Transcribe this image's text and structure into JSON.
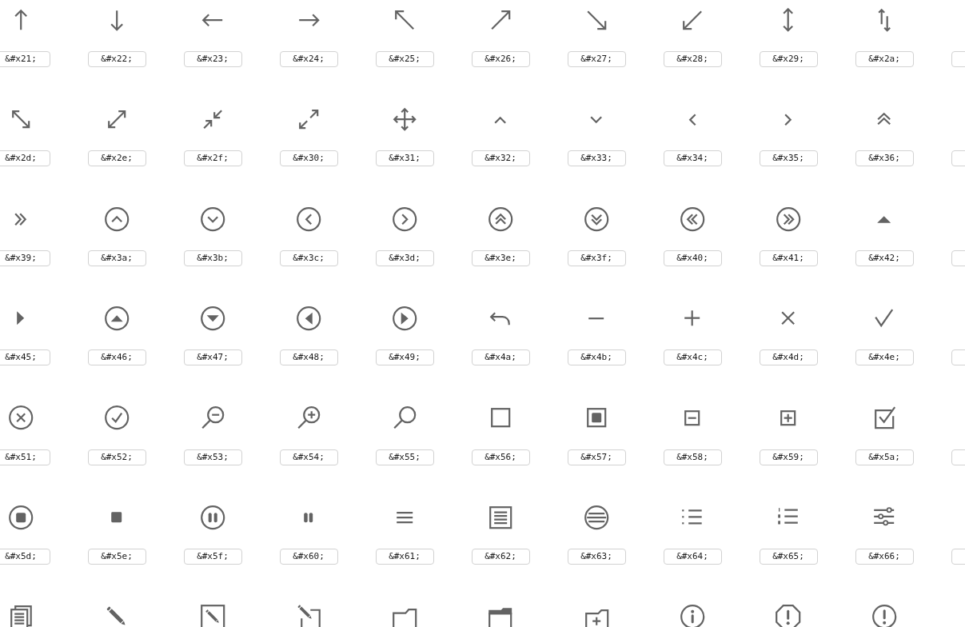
{
  "icon_grid": {
    "rows": [
      {
        "cells": [
          {
            "kind": "arrow-up",
            "code": "&#x21;"
          },
          {
            "kind": "arrow-down",
            "code": "&#x22;"
          },
          {
            "kind": "arrow-left",
            "code": "&#x23;"
          },
          {
            "kind": "arrow-right",
            "code": "&#x24;"
          },
          {
            "kind": "arrow-up-left",
            "code": "&#x25;"
          },
          {
            "kind": "arrow-up-right",
            "code": "&#x26;"
          },
          {
            "kind": "arrow-down-right",
            "code": "&#x27;"
          },
          {
            "kind": "arrow-down-left",
            "code": "&#x28;"
          },
          {
            "kind": "double-arrow-vertical",
            "code": "&#x29;"
          },
          {
            "kind": "up-down-arrows",
            "code": "&#x2a;"
          }
        ]
      },
      {
        "cells": [
          {
            "kind": "double-arrow-diagonal-down",
            "code": "&#x2d;"
          },
          {
            "kind": "double-arrow-diagonal-up",
            "code": "&#x2e;"
          },
          {
            "kind": "collapse-arrows",
            "code": "&#x2f;"
          },
          {
            "kind": "expand-arrows",
            "code": "&#x30;"
          },
          {
            "kind": "move-arrows",
            "code": "&#x31;"
          },
          {
            "kind": "chevron-up",
            "code": "&#x32;"
          },
          {
            "kind": "chevron-down",
            "code": "&#x33;"
          },
          {
            "kind": "chevron-left",
            "code": "&#x34;"
          },
          {
            "kind": "chevron-right",
            "code": "&#x35;"
          },
          {
            "kind": "double-chevron-up",
            "code": "&#x36;"
          }
        ]
      },
      {
        "cells": [
          {
            "kind": "double-chevron-right",
            "code": "&#x39;"
          },
          {
            "kind": "circle-chevron-up",
            "code": "&#x3a;"
          },
          {
            "kind": "circle-chevron-down",
            "code": "&#x3b;"
          },
          {
            "kind": "circle-chevron-left",
            "code": "&#x3c;"
          },
          {
            "kind": "circle-chevron-right",
            "code": "&#x3d;"
          },
          {
            "kind": "circle-double-chevron-up",
            "code": "&#x3e;"
          },
          {
            "kind": "circle-double-chevron-down",
            "code": "&#x3f;"
          },
          {
            "kind": "circle-double-chevron-left",
            "code": "&#x40;"
          },
          {
            "kind": "circle-double-chevron-right",
            "code": "&#x41;"
          },
          {
            "kind": "triangle-up",
            "code": "&#x42;"
          }
        ]
      },
      {
        "cells": [
          {
            "kind": "triangle-right",
            "code": "&#x45;"
          },
          {
            "kind": "circle-triangle-up",
            "code": "&#x46;"
          },
          {
            "kind": "circle-triangle-down",
            "code": "&#x47;"
          },
          {
            "kind": "circle-triangle-left",
            "code": "&#x48;"
          },
          {
            "kind": "circle-triangle-right",
            "code": "&#x49;"
          },
          {
            "kind": "curved-arrow-left",
            "code": "&#x4a;"
          },
          {
            "kind": "minus",
            "code": "&#x4b;"
          },
          {
            "kind": "plus",
            "code": "&#x4c;"
          },
          {
            "kind": "close",
            "code": "&#x4d;"
          },
          {
            "kind": "checkmark",
            "code": "&#x4e;"
          }
        ]
      },
      {
        "cells": [
          {
            "kind": "circle-x",
            "code": "&#x51;"
          },
          {
            "kind": "circle-checkmark",
            "code": "&#x52;"
          },
          {
            "kind": "zoom-out",
            "code": "&#x53;"
          },
          {
            "kind": "zoom-in",
            "code": "&#x54;"
          },
          {
            "kind": "search",
            "code": "&#x55;"
          },
          {
            "kind": "square",
            "code": "&#x56;"
          },
          {
            "kind": "square-dot",
            "code": "&#x57;"
          },
          {
            "kind": "square-minus",
            "code": "&#x58;"
          },
          {
            "kind": "square-plus",
            "code": "&#x59;"
          },
          {
            "kind": "checked-box",
            "code": "&#x5a;"
          }
        ]
      },
      {
        "cells": [
          {
            "kind": "circle-stop",
            "code": "&#x5d;"
          },
          {
            "kind": "stop",
            "code": "&#x5e;"
          },
          {
            "kind": "circle-pause",
            "code": "&#x5f;"
          },
          {
            "kind": "pause",
            "code": "&#x60;"
          },
          {
            "kind": "menu",
            "code": "&#x61;"
          },
          {
            "kind": "document-lines",
            "code": "&#x62;"
          },
          {
            "kind": "circle-lines",
            "code": "&#x63;"
          },
          {
            "kind": "bulleted-list",
            "code": "&#x64;"
          },
          {
            "kind": "numbered-list",
            "code": "&#x65;"
          },
          {
            "kind": "sliders",
            "code": "&#x66;"
          }
        ]
      },
      {
        "cells": [
          {
            "kind": "documents"
          },
          {
            "kind": "pencil"
          },
          {
            "kind": "pencil-square"
          },
          {
            "kind": "pencil-box"
          },
          {
            "kind": "folder"
          },
          {
            "kind": "folder-filled-tab"
          },
          {
            "kind": "folder-plus"
          },
          {
            "kind": "info"
          },
          {
            "kind": "exclamation-octagon"
          },
          {
            "kind": "exclamation-circle"
          }
        ]
      }
    ]
  }
}
